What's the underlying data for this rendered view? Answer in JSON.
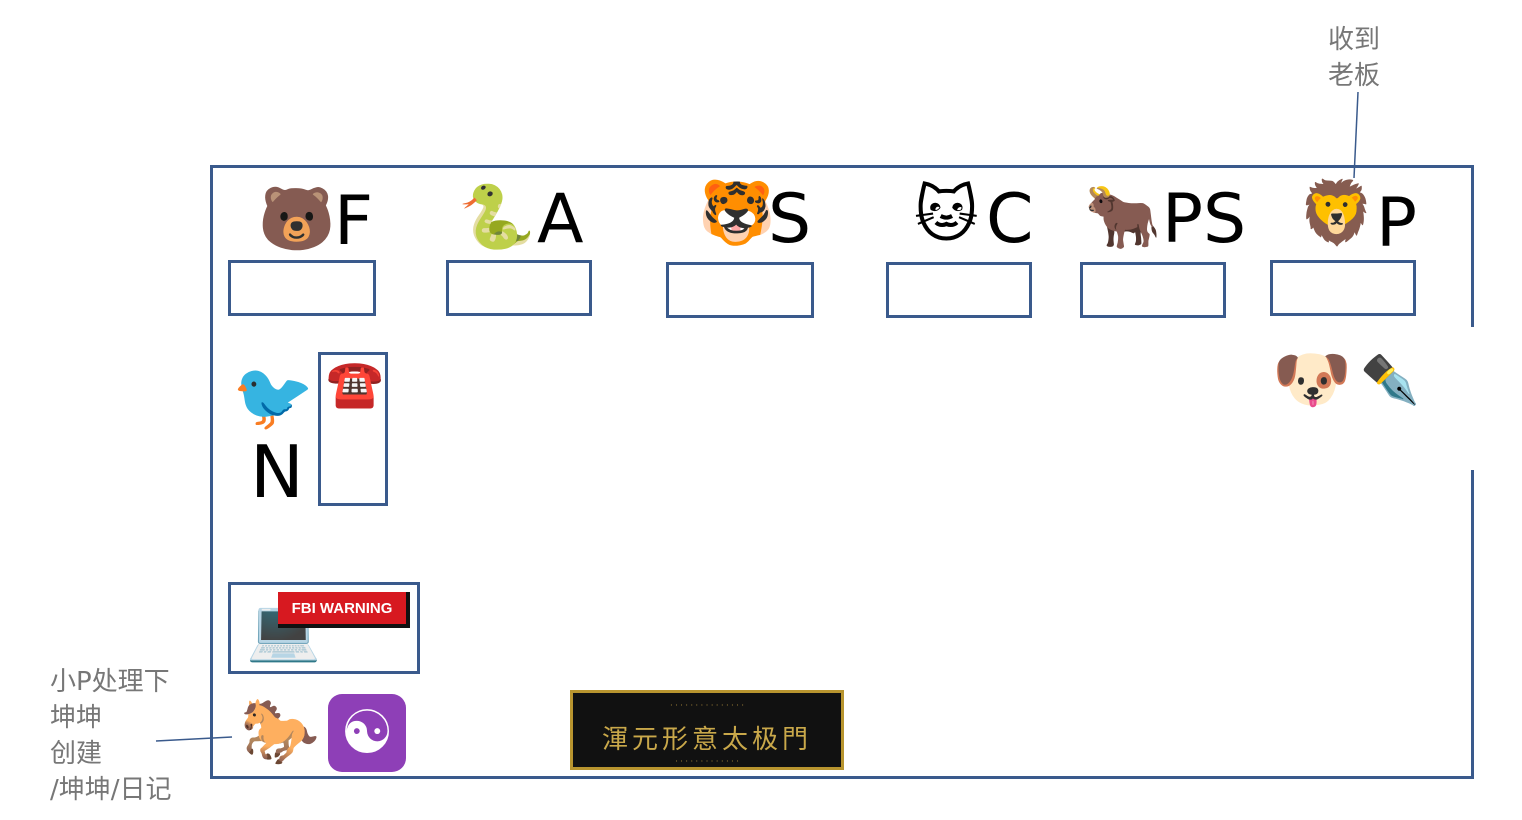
{
  "annotations": {
    "top_right_note": "收到\n老板",
    "bottom_left_note": "小P处理下\n坤坤\n创建\n/坤坤/日记"
  },
  "seats": [
    {
      "emoji": "🐻",
      "letter": "F"
    },
    {
      "emoji": "🐍",
      "letter": "A"
    },
    {
      "emoji": "🐯",
      "letter": "S"
    },
    {
      "emoji": "🐱",
      "letter": "C"
    },
    {
      "emoji": "🐂",
      "letter": "PS"
    },
    {
      "emoji": "🦁",
      "letter": "P"
    }
  ],
  "side_seat": {
    "emoji": "🐦",
    "letter": "N",
    "desk_item": "☎️"
  },
  "dog_desk": {
    "emoji": "🐶",
    "tool": "✒️"
  },
  "laptop_desk": {
    "device": "💻",
    "warning": "FBI WARNING"
  },
  "bottom_items": {
    "horse": "🐎",
    "taiji": "☯"
  },
  "plaque": {
    "title": "渾元形意太极門"
  },
  "colors": {
    "wall": "#3a5a8c",
    "note_text": "#777777",
    "fbi_red": "#d71920",
    "taiji_bg": "#8e3fb7"
  }
}
